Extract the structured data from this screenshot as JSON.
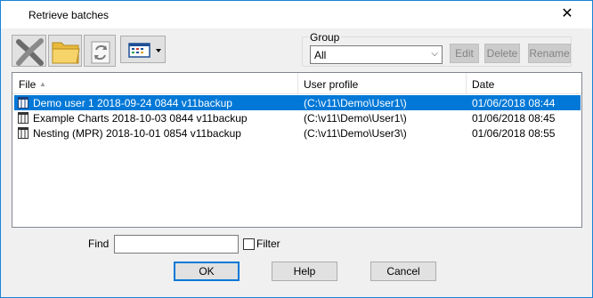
{
  "window": {
    "title": "Retrieve batches",
    "close_glyph": "✕"
  },
  "toolbar": {
    "buttons": [
      {
        "icon": "delete-icon"
      },
      {
        "icon": "folder-icon"
      },
      {
        "icon": "refresh-icon"
      },
      {
        "icon": "view-options-icon"
      }
    ]
  },
  "group": {
    "label": "Group",
    "selected": "All",
    "edit_label": "Edit",
    "delete_label": "Delete",
    "rename_label": "Rename"
  },
  "list": {
    "columns": [
      "File",
      "User profile",
      "Date"
    ],
    "sort_indicator": "▲",
    "rows": [
      {
        "file": "Demo user 1 2018-09-24 0844 v11backup",
        "user_profile": "(C:\\v11\\Demo\\User1\\)",
        "date": "01/06/2018  08:44",
        "selected": true
      },
      {
        "file": "Example Charts 2018-10-03 0844 v11backup",
        "user_profile": "(C:\\v11\\Demo\\User1\\)",
        "date": "01/06/2018  08:45",
        "selected": false
      },
      {
        "file": "Nesting (MPR) 2018-10-01 0854 v11backup",
        "user_profile": "(C:\\v11\\Demo\\User3\\)",
        "date": "01/06/2018  08:55",
        "selected": false
      }
    ]
  },
  "find": {
    "label": "Find",
    "value": ""
  },
  "filter": {
    "label": "Filter",
    "checked": false
  },
  "buttons": {
    "ok": "OK",
    "help": "Help",
    "cancel": "Cancel"
  },
  "colors": {
    "accent": "#0078d7",
    "window_border": "#1883d7"
  }
}
